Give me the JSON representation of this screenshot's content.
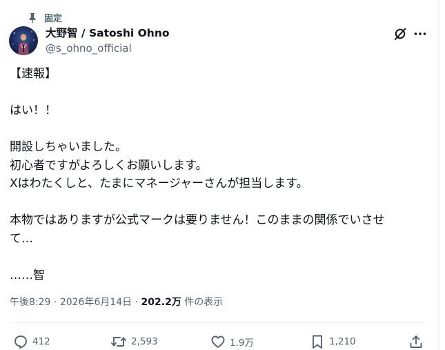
{
  "pinned": {
    "label": "固定",
    "icon": "pin-icon"
  },
  "author": {
    "display_name": "大野智 / Satoshi Ohno",
    "handle": "@s_ohno_official",
    "avatar": "avatar-photo"
  },
  "header_icons": [
    "grok-icon",
    "more-icon"
  ],
  "tweet": {
    "lines": [
      "【速報】",
      "",
      "はい！！",
      "",
      "開設しちゃいました。",
      "初心者ですがよろしくお願いします。",
      "Xはわたくしと、たまにマネージャーさんが担当します。",
      "",
      "本物ではありますが公式マークは要りません！このままの関係でいさせ",
      "て…",
      "",
      "……智"
    ]
  },
  "meta": {
    "time": "午後8:29",
    "sep1": " · ",
    "date": "2026年6月14日",
    "sep2": " · ",
    "views_count": "202.2万",
    "views_suffix": " 件の表示"
  },
  "actions": {
    "reply": {
      "count": "412",
      "icon": "reply-icon"
    },
    "repost": {
      "count": "2,593",
      "icon": "repost-icon"
    },
    "like": {
      "count": "1.9万",
      "icon": "like-icon"
    },
    "bookmark": {
      "count": "1,210",
      "icon": "bookmark-icon"
    },
    "share": {
      "icon": "share-icon"
    }
  },
  "colors": {
    "text_primary": "#0f1419",
    "text_secondary": "#536471",
    "divider": "#eff3f4"
  }
}
